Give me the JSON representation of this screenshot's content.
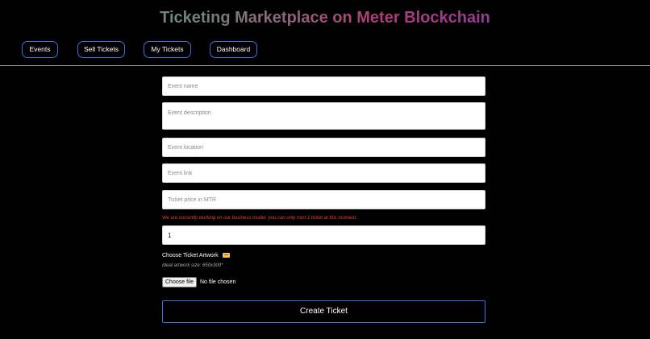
{
  "header": {
    "title": "Ticketing Marketplace on Meter Blockchain"
  },
  "nav": {
    "events": "Events",
    "sell_tickets": "Sell Tickets",
    "my_tickets": "My Tickets",
    "dashboard": "Dashboard"
  },
  "form": {
    "event_name_placeholder": "Event name",
    "event_description_placeholder": "Event description",
    "event_location_placeholder": "Event location",
    "event_link_placeholder": "Event link",
    "ticket_price_placeholder": "Ticket price in MTR",
    "warning": "We are currently working on our business model, you can only mint 1 ticket at this moment.",
    "quantity_value": "1",
    "artwork_label": "Choose Ticket Artwork",
    "artwork_hint": "Ideal artwork size: 650x300*",
    "choose_file_label": "Choose file",
    "file_status": "No file chosen",
    "submit_label": "Create Ticket"
  },
  "colors": {
    "accent": "#3d6fe0",
    "warning": "#e0453a",
    "background": "#000000"
  }
}
